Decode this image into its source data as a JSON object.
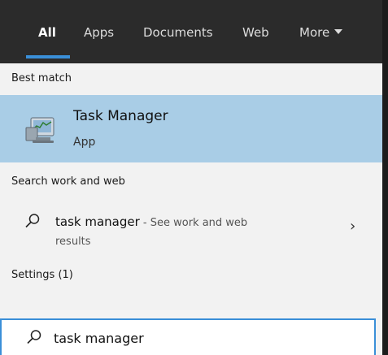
{
  "tabs": [
    {
      "label": "All"
    },
    {
      "label": "Apps"
    },
    {
      "label": "Documents"
    },
    {
      "label": "Web"
    },
    {
      "label": "More"
    }
  ],
  "best_match": {
    "heading": "Best match",
    "title": "Task Manager",
    "subtitle": "App",
    "icon": "task-manager-icon"
  },
  "search_work_web": {
    "heading": "Search work and web",
    "query": "task manager",
    "suffix": " - See work and web",
    "suffix_line2": "results"
  },
  "settings": {
    "heading": "Settings (1)"
  },
  "searchbox": {
    "value": "task manager"
  },
  "colors": {
    "accent": "#3a8fd8",
    "highlight": "#a9cde6",
    "header": "#2b2b2b"
  }
}
